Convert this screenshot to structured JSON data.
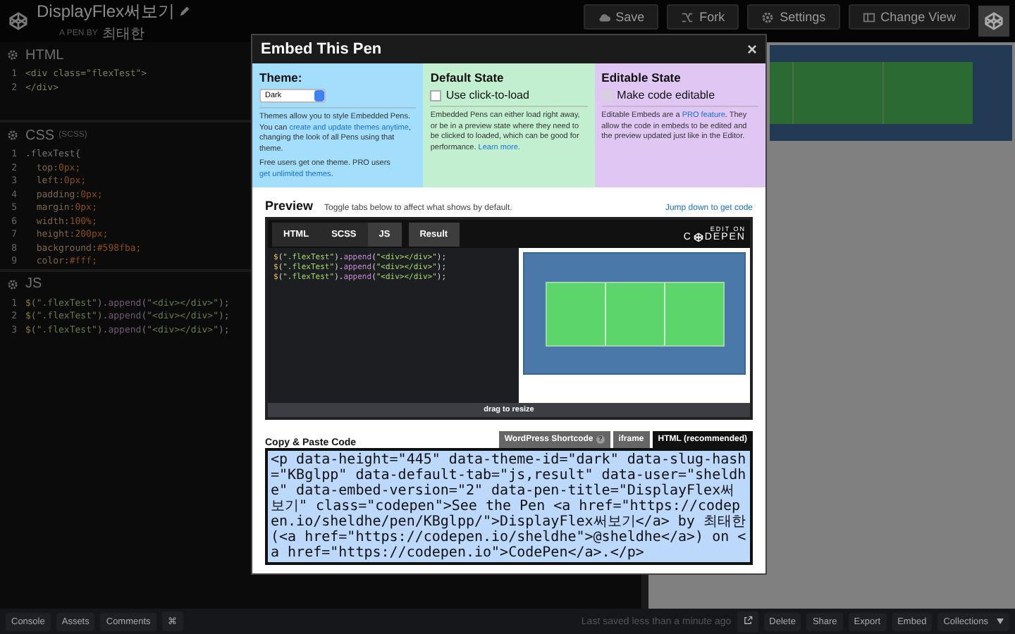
{
  "header": {
    "title": "DisplayFlex써보기",
    "byline": "A PEN BY",
    "author": "최태한",
    "buttons": [
      "Save",
      "Fork",
      "Settings",
      "Change View"
    ]
  },
  "editor": {
    "panels": [
      {
        "title": "HTML",
        "lines": [
          {
            "n": "1",
            "code": "<div class=\"flexTest\">"
          },
          {
            "n": "2",
            "code": "</div>"
          }
        ]
      },
      {
        "title": "CSS",
        "subtitle": "(SCSS)",
        "lines": [
          {
            "n": "1",
            "code": ".flexTest{"
          },
          {
            "n": "2",
            "code": "  top:0px;"
          },
          {
            "n": "3",
            "code": "  left:0px;"
          },
          {
            "n": "4",
            "code": "  padding:0px;"
          },
          {
            "n": "5",
            "code": "  margin:0px;"
          },
          {
            "n": "6",
            "code": "  width:100%;"
          },
          {
            "n": "7",
            "code": "  height:200px;"
          },
          {
            "n": "8",
            "code": "  background:#598fba;"
          },
          {
            "n": "9",
            "code": "  color:#fff;"
          }
        ]
      },
      {
        "title": "JS",
        "lines": [
          {
            "n": "1",
            "code": "$(\".flexTest\").append(\"<div></div>\");"
          },
          {
            "n": "2",
            "code": "$(\".flexTest\").append(\"<div></div>\");"
          },
          {
            "n": "3",
            "code": "$(\".flexTest\").append(\"<div></div>\");"
          }
        ]
      }
    ]
  },
  "embed_dialog": {
    "title": "Embed This Pen",
    "close": "×",
    "options": [
      {
        "kind": "theme",
        "color": "#a3dffc",
        "heading": "Theme:",
        "select_value": "Dark",
        "paragraphs": [
          [
            {
              "text": "Themes allow you to style Embedded Pens. You can "
            },
            {
              "text": "create and update themes anytime",
              "link": true
            },
            {
              "text": ", changing the look of all Pens using that theme."
            }
          ],
          [
            {
              "text": "Free users get one theme. PRO users "
            },
            {
              "text": "get unlimited themes",
              "link": true
            },
            {
              "text": "."
            }
          ]
        ]
      },
      {
        "kind": "checkbox",
        "color": "#c1efd0",
        "heading": "Default State",
        "label": "Use click-to-load",
        "checked": false,
        "disabled": false,
        "paragraphs": [
          [
            {
              "text": "Embedded Pens can either load right away, or be in a preview state where they need to be clicked to loaded, which can be good for performance. "
            },
            {
              "text": "Learn more.",
              "link": true
            }
          ]
        ]
      },
      {
        "kind": "checkbox",
        "color": "#e0c7f3",
        "heading": "Editable State",
        "label": "Make code editable",
        "checked": false,
        "disabled": true,
        "paragraphs": [
          [
            {
              "text": "Editable Embeds are a "
            },
            {
              "text": "PRO feature",
              "link": true
            },
            {
              "text": ". They allow the code in embeds to be edited and the preview updated just like in the Editor."
            }
          ]
        ]
      }
    ],
    "preview": {
      "title": "Preview",
      "hint": "Toggle tabs below to affect what shows by default.",
      "jump_link": "Jump down to get code",
      "tabs": [
        {
          "label": "HTML",
          "selected": false
        },
        {
          "label": "SCSS",
          "selected": false
        },
        {
          "label": "JS",
          "selected": true
        },
        {
          "label": "Result",
          "selected": true
        }
      ],
      "brand_top": "EDIT ON",
      "brand_left": "C",
      "brand_right": "DEPEN",
      "code_lines": [
        "$(\".flexTest\").append(\"<div></div>\");",
        "$(\".flexTest\").append(\"<div></div>\");",
        "$(\".flexTest\").append(\"<div></div>\");"
      ],
      "resize_label": "drag to resize"
    },
    "copy": {
      "title": "Copy & Paste Code",
      "tabs": [
        {
          "label": "WordPress Shortcode",
          "help": "?",
          "selected": false
        },
        {
          "label": "iframe",
          "selected": false
        },
        {
          "label": "HTML (recommended)",
          "selected": true
        }
      ],
      "code": "<p data-height=\"445\" data-theme-id=\"dark\" data-slug-hash=\"KBglpp\" data-default-tab=\"js,result\" data-user=\"sheldhe\" data-embed-version=\"2\" data-pen-title=\"DisplayFlex써보기\" class=\"codepen\">See the Pen <a href=\"https://codepen.io/sheldhe/pen/KBglpp/\">DisplayFlex써보기</a> by 최태한 (<a href=\"https://codepen.io/sheldhe\">@sheldhe</a>) on <a href=\"https://codepen.io\">CodePen</a>.</p>"
    }
  },
  "footer": {
    "left_buttons": [
      "Console",
      "Assets",
      "Comments",
      "⌘"
    ],
    "status": "Last saved less than a minute ago",
    "right_buttons": [
      "Delete",
      "Share",
      "Export",
      "Embed",
      "Collections"
    ]
  }
}
